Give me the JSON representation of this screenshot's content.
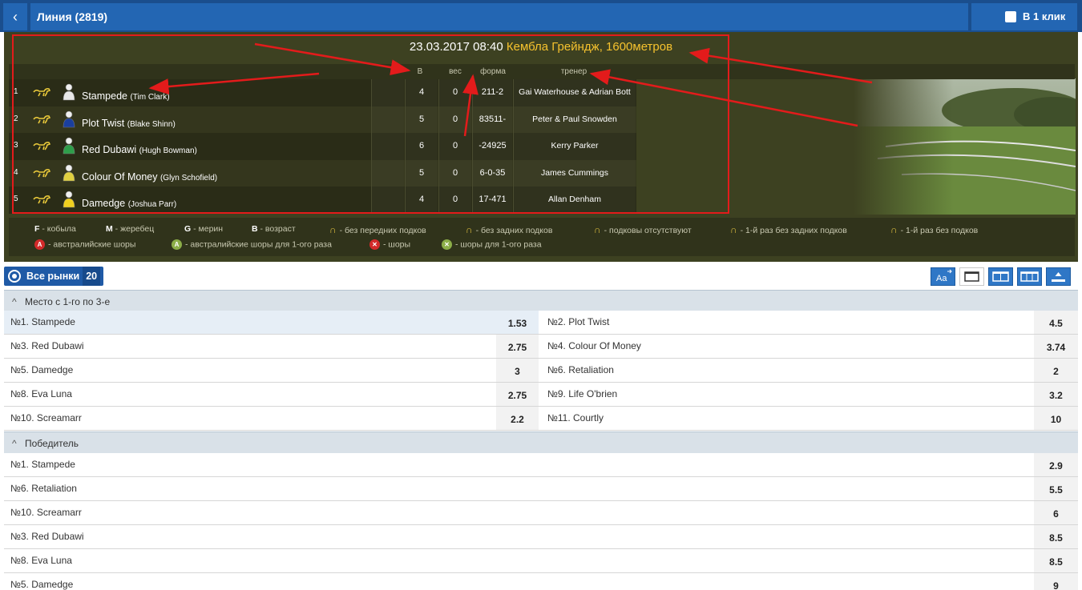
{
  "header": {
    "back_label": "‹",
    "title": "Линия (2819)",
    "one_click": "В 1 клик"
  },
  "race": {
    "datetime": "23.03.2017 08:40",
    "venue": "Кембла Грейндж, 1600метров",
    "columns": {
      "b": "В",
      "weight": "вес",
      "form": "форма",
      "trainer": "тренер"
    },
    "runners": [
      {
        "num": "1",
        "horse": "Stampede",
        "jockey": "(Tim Clark)",
        "b": "4",
        "weight": "0",
        "form": "211-2",
        "trainer": "Gai Waterhouse & Adrian Bott",
        "silk": "#e8e8e8"
      },
      {
        "num": "2",
        "horse": "Plot Twist",
        "jockey": "(Blake Shinn)",
        "b": "5",
        "weight": "0",
        "form": "83511-",
        "trainer": "Peter & Paul Snowden",
        "silk": "#1a3f9e"
      },
      {
        "num": "3",
        "horse": "Red Dubawi",
        "jockey": "(Hugh Bowman)",
        "b": "6",
        "weight": "0",
        "form": "-24925",
        "trainer": "Kerry Parker",
        "silk": "#2e9e4a"
      },
      {
        "num": "4",
        "horse": "Colour Of Money",
        "jockey": "(Glyn Schofield)",
        "b": "5",
        "weight": "0",
        "form": "6-0-35",
        "trainer": "James Cummings",
        "silk": "#e0d040"
      },
      {
        "num": "5",
        "horse": "Damedge",
        "jockey": "(Joshua Parr)",
        "b": "4",
        "weight": "0",
        "form": "17-471",
        "trainer": "Allan Denham",
        "silk": "#f0d020"
      }
    ],
    "legend": {
      "f_key": "F",
      "f_label": "- кобыла",
      "m_key": "M",
      "m_label": "- жеребец",
      "g_key": "G",
      "g_label": "- мерин",
      "b_key": "В",
      "b_label": "- возраст",
      "front_shoes": "- без передних подков",
      "rear_shoes": "- без задних подков",
      "no_shoes": "- подковы отсутствуют",
      "first_rear": "- 1-й раз без задних подков",
      "first_shoes": "- 1-й раз без подков",
      "a_key": "A",
      "aus_blinkers": "- австралийские шоры",
      "aus_blinkers_first": "- австралийские шоры для 1-ого раза",
      "x_key": "✕",
      "blinkers": "- шоры",
      "blinkers_first": "- шоры для 1-ого раза"
    }
  },
  "markets": {
    "all_label": "Все рынки",
    "all_count": "20",
    "place": {
      "title": "Место с 1-го по 3-е",
      "rows": [
        {
          "left": "№1. Stampede",
          "left_odd": "1.53",
          "right": "№2. Plot Twist",
          "right_odd": "4.5"
        },
        {
          "left": "№3. Red Dubawi",
          "left_odd": "2.75",
          "right": "№4. Colour Of Money",
          "right_odd": "3.74"
        },
        {
          "left": "№5. Damedge",
          "left_odd": "3",
          "right": "№6. Retaliation",
          "right_odd": "2"
        },
        {
          "left": "№8. Eva Luna",
          "left_odd": "2.75",
          "right": "№9. Life O'brien",
          "right_odd": "3.2"
        },
        {
          "left": "№10. Screamarr",
          "left_odd": "2.2",
          "right": "№11. Courtly",
          "right_odd": "10"
        }
      ]
    },
    "winner": {
      "title": "Победитель",
      "rows": [
        {
          "name": "№1. Stampede",
          "odd": "2.9"
        },
        {
          "name": "№6. Retaliation",
          "odd": "5.5"
        },
        {
          "name": "№10. Screamarr",
          "odd": "6"
        },
        {
          "name": "№3. Red Dubawi",
          "odd": "8.5"
        },
        {
          "name": "№8. Eva Luna",
          "odd": "8.5"
        },
        {
          "name": "№5. Damedge",
          "odd": "9"
        }
      ]
    }
  }
}
